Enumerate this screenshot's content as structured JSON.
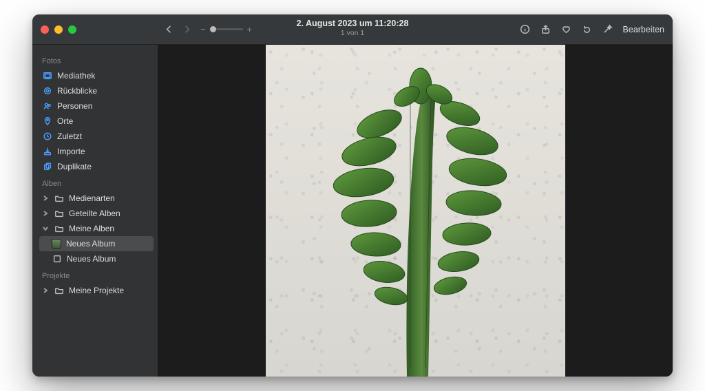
{
  "titlebar": {
    "title": "2. August 2023 um 11:20:28",
    "subtitle": "1 von 1",
    "edit_label": "Bearbeiten",
    "zoom_minus": "−",
    "zoom_plus": "+"
  },
  "sidebar": {
    "sections": {
      "fotos_label": "Fotos",
      "alben_label": "Alben",
      "projekte_label": "Projekte"
    },
    "fotos": [
      {
        "label": "Mediathek"
      },
      {
        "label": "Rückblicke"
      },
      {
        "label": "Personen"
      },
      {
        "label": "Orte"
      },
      {
        "label": "Zuletzt"
      },
      {
        "label": "Importe"
      },
      {
        "label": "Duplikate"
      }
    ],
    "alben": {
      "medienarten": "Medienarten",
      "geteilte": "Geteilte Alben",
      "meine": "Meine Alben",
      "neues1": "Neues Album",
      "neues2": "Neues Album"
    },
    "projekte": {
      "meine": "Meine Projekte"
    }
  }
}
